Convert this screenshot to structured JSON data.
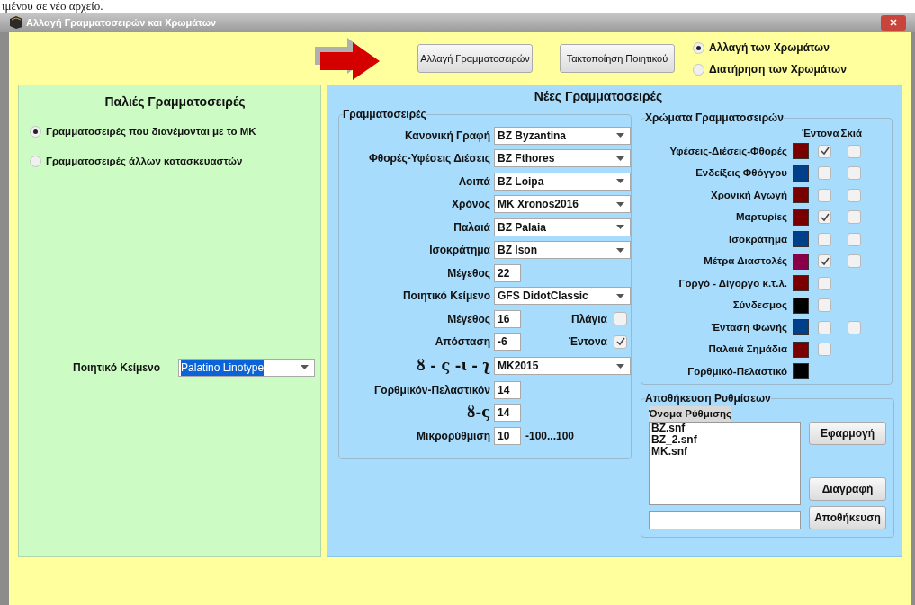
{
  "background_text": "ιμένου σε νέο αρχείο.",
  "window": {
    "title": "Αλλαγή Γραμματοσειρών και Χρωμάτων"
  },
  "toolbar": {
    "buttons": [
      "Αλλαγή Γραμματοσειρών",
      "Τακτοποίηση Ποιητικού"
    ],
    "color_options": [
      {
        "label": "Αλλαγή των Χρωμάτων",
        "selected": true
      },
      {
        "label": "Διατήρηση των Χρωμάτων",
        "selected": false
      }
    ]
  },
  "old_fonts": {
    "title": "Παλιές Γραμματοσειρές",
    "options": [
      {
        "label": "Γραμματοσειρές που διανέμονται με το ΜΚ",
        "selected": true
      },
      {
        "label": "Γραμματοσειρές άλλων κατασκευαστών",
        "selected": false
      }
    ],
    "poetic_label": "Ποιητικό Κείμενο",
    "poetic_value": "Palatino Linotype"
  },
  "new_fonts": {
    "title": "Νέες Γραμματοσειρές",
    "fonts_group": {
      "title": "Γραμματοσειρές",
      "rows": [
        {
          "kind": "combo",
          "label": "Κανονική Γραφή",
          "value": "BZ Byzantina"
        },
        {
          "kind": "combo",
          "label": "Φθορές-Υφέσεις Διέσεις",
          "value": "BZ Fthores"
        },
        {
          "kind": "combo",
          "label": "Λοιπά",
          "value": "BZ Loipa"
        },
        {
          "kind": "combo",
          "label": "Χρόνος",
          "value": "MK Xronos2016"
        },
        {
          "kind": "combo",
          "label": "Παλαιά",
          "value": "BZ Palaia"
        },
        {
          "kind": "combo",
          "label": "Ισοκράτημα",
          "value": "BZ Ison"
        },
        {
          "kind": "number",
          "label": "Μέγεθος",
          "value": "22"
        },
        {
          "kind": "combo",
          "label": "Ποιητικό Κείμενο",
          "value": "GFS DidotClassic"
        },
        {
          "kind": "check",
          "label": "Μέγεθος",
          "value": "16",
          "check_label": "Πλάγια",
          "checked": false
        },
        {
          "kind": "check",
          "label": "Απόσταση",
          "value": "-6",
          "check_label": "Έντονα",
          "checked": true
        },
        {
          "kind": "glyph_combo",
          "label": "ȣ - ς -ɩ - ʅ",
          "value": "MK2015"
        },
        {
          "kind": "number",
          "label": "Γορθμικόν-Πελαστικόν",
          "value": "14"
        },
        {
          "kind": "glyph_number",
          "label": "ȣ-ς",
          "value": "14"
        },
        {
          "kind": "hint",
          "label": "Μικρορύθμιση",
          "value": "10",
          "hint": "-100...100"
        }
      ]
    },
    "colors_group": {
      "title": "Χρώματα Γραμματοσειρών",
      "columns": [
        "Έντονα",
        "Σκιά"
      ],
      "rows": [
        {
          "label": "Υφέσεις-Διέσεις-Φθορές",
          "color": "#7a0000",
          "bold": true,
          "shadow": false
        },
        {
          "label": "Ενδείξεις Φθόγγου",
          "color": "#003f8a",
          "bold": false,
          "shadow": false
        },
        {
          "label": "Χρονική Αγωγή",
          "color": "#7a0000",
          "bold": false,
          "shadow": false
        },
        {
          "label": "Μαρτυρίες",
          "color": "#7a0000",
          "bold": true,
          "shadow": false
        },
        {
          "label": "Ισοκράτημα",
          "color": "#003f8a",
          "bold": false,
          "shadow": false
        },
        {
          "label": "Μέτρα Διαστολές",
          "color": "#8a0048",
          "bold": true,
          "shadow": false
        },
        {
          "label": "Γοργό - Δίγοργο κ.τ.λ.",
          "color": "#7a0000",
          "bold": false
        },
        {
          "label": "Σύνδεσμος",
          "color": "#000000",
          "bold": false
        },
        {
          "label": "Ένταση Φωνής",
          "color": "#003f8a",
          "bold": false,
          "shadow": false
        },
        {
          "label": "Παλαιά Σημάδια",
          "color": "#7a0000",
          "bold": false
        },
        {
          "label": "Γορθμικό-Πελαστικό",
          "color": "#000000"
        }
      ]
    },
    "save_group": {
      "title": "Αποθήκευση Ρυθμίσεων",
      "list_header": "Όνομα Ρύθμισης",
      "files": [
        "BZ.snf",
        "BZ_2.snf",
        "MK.snf"
      ],
      "buttons": [
        "Εφαρμογή",
        "Διαγραφή",
        "Αποθήκευση"
      ]
    }
  }
}
